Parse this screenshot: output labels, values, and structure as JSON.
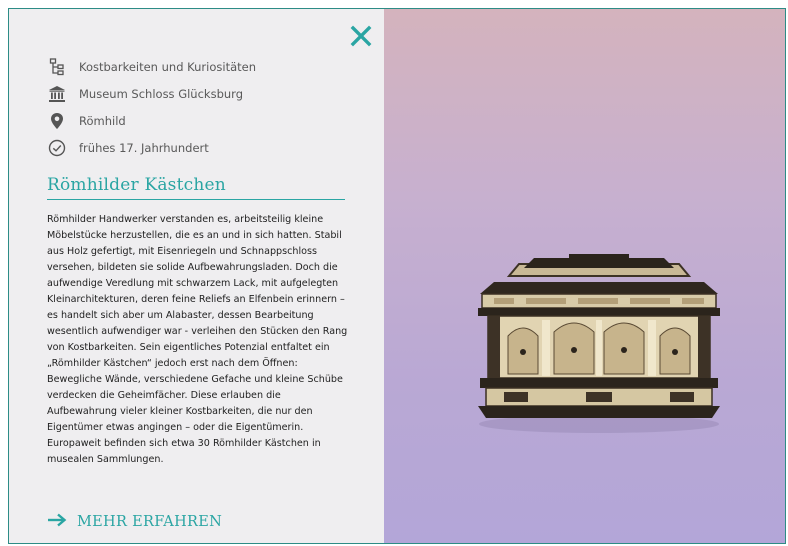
{
  "panel": {
    "meta": [
      {
        "icon": "category-icon",
        "text": "Kostbarkeiten und Kuriositäten"
      },
      {
        "icon": "museum-icon",
        "text": "Museum Schloss Glücksburg"
      },
      {
        "icon": "location-pin-icon",
        "text": "Römhild"
      },
      {
        "icon": "check-circle-icon",
        "text": "frühes 17. Jahrhundert"
      }
    ],
    "title": "Römhilder Kästchen",
    "description": "Römhilder Handwerker verstanden es, arbeitsteilig kleine Möbelstücke herzustellen, die es an und in sich hatten. Stabil aus Holz gefertigt, mit Eisenriegeln und Schnappschloss versehen, bildeten sie solide Aufbewahrungsladen. Doch die aufwendige Veredlung mit schwarzem Lack, mit aufgelegten Kleinarchitekturen, deren feine Reliefs an Elfenbein erinnern – es handelt sich aber um Alabaster, dessen Bearbeitung wesentlich aufwendiger war - verleihen den Stücken den Rang von Kostbarkeiten. Sein eigentliches Potenzial entfaltet ein „Römhilder Kästchen“ jedoch erst nach dem Öffnen: Bewegliche Wände, verschiedene Gefache und kleine Schübe verdecken die Geheimfächer. Diese erlauben die Aufbewahrung vieler kleiner Kostbarkeiten, die nur den Eigentümer etwas angingen – oder die Eigentümerin. Europaweit befinden sich etwa 30 Römhilder Kästchen in musealen Sammlungen.",
    "more_label": "MEHR ERFAHREN"
  },
  "colors": {
    "accent": "#2aa5a3",
    "panel_bg": "#efeef0",
    "image_bg_top": "#d4b3bd",
    "image_bg_bottom": "#b3a6d8"
  }
}
